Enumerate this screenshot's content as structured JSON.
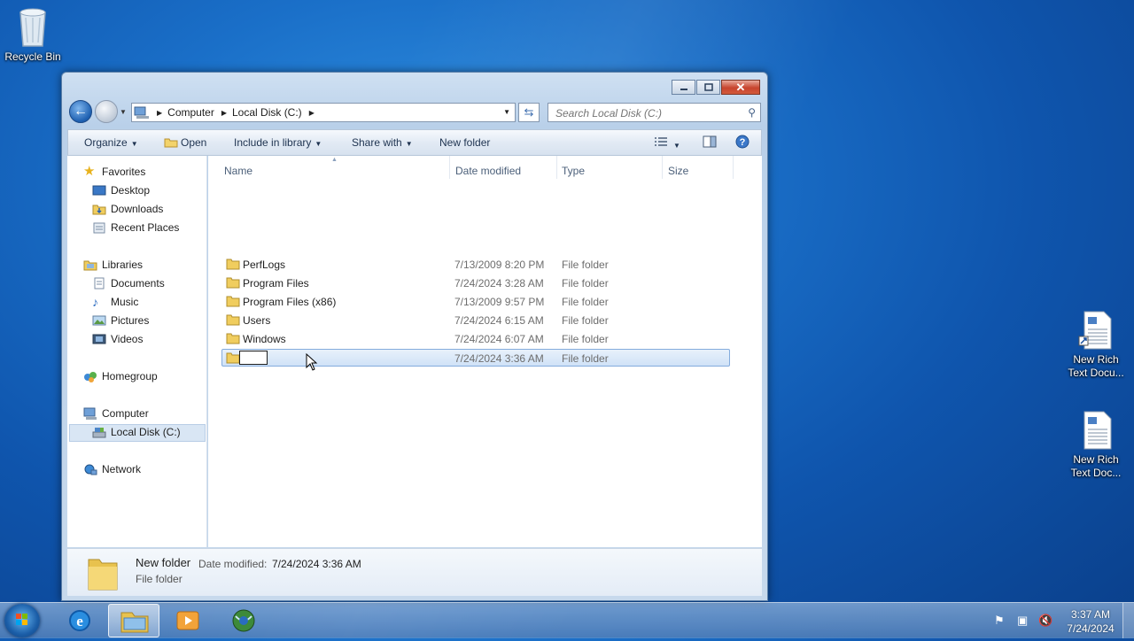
{
  "desktop": {
    "icons": [
      {
        "label": "Recycle Bin"
      },
      {
        "label_line1": "New Rich",
        "label_line2": "Text Docu..."
      },
      {
        "label_line1": "New Rich",
        "label_line2": "Text Doc..."
      }
    ]
  },
  "window": {
    "address": {
      "segments": [
        "Computer",
        "Local Disk (C:)"
      ]
    },
    "search": {
      "placeholder": "Search Local Disk (C:)"
    },
    "toolbar": {
      "organize": "Organize",
      "open": "Open",
      "include_in_library": "Include in library",
      "share_with": "Share with",
      "new_folder": "New folder"
    },
    "nav": {
      "favorites": "Favorites",
      "desktop": "Desktop",
      "downloads": "Downloads",
      "recent_places": "Recent Places",
      "libraries": "Libraries",
      "documents": "Documents",
      "music": "Music",
      "pictures": "Pictures",
      "videos": "Videos",
      "homegroup": "Homegroup",
      "computer": "Computer",
      "local_disk": "Local Disk (C:)",
      "network": "Network"
    },
    "columns": {
      "name": "Name",
      "date_modified": "Date modified",
      "type": "Type",
      "size": "Size"
    },
    "files": [
      {
        "name": "PerfLogs",
        "date": "7/13/2009 8:20 PM",
        "type": "File folder"
      },
      {
        "name": "Program Files",
        "date": "7/24/2024 3:28 AM",
        "type": "File folder"
      },
      {
        "name": "Program Files (x86)",
        "date": "7/13/2009 9:57 PM",
        "type": "File folder"
      },
      {
        "name": "Users",
        "date": "7/24/2024 6:15 AM",
        "type": "File folder"
      },
      {
        "name": "Windows",
        "date": "7/24/2024 6:07 AM",
        "type": "File folder"
      },
      {
        "name": "",
        "date": "7/24/2024 3:36 AM",
        "type": "File folder"
      }
    ],
    "details": {
      "name": "New folder",
      "date_label": "Date modified:",
      "date_value": "7/24/2024 3:36 AM",
      "type": "File folder"
    }
  },
  "taskbar": {
    "time": "3:37 AM",
    "date": "7/24/2024"
  }
}
